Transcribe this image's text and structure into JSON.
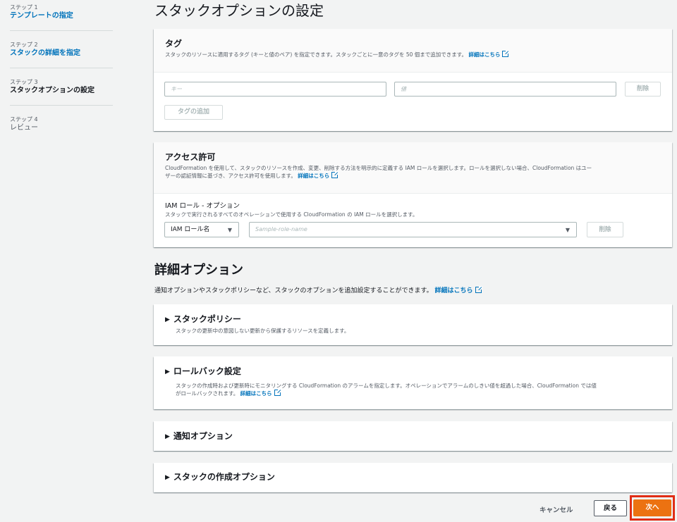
{
  "sidebar": {
    "steps": [
      {
        "num": "ステップ 1",
        "title": "テンプレートの指定"
      },
      {
        "num": "ステップ 2",
        "title": "スタックの詳細を指定"
      },
      {
        "num": "ステップ 3",
        "title": "スタックオプションの設定"
      },
      {
        "num": "ステップ 4",
        "title": "レビュー"
      }
    ]
  },
  "page_title": "スタックオプションの設定",
  "tags_panel": {
    "title": "タグ",
    "desc": "スタックのリソースに適用するタグ (キーと値のペア) を指定できます。スタックごとに一意のタグを 50 個まで追加できます。",
    "learn_more": "詳細はこちら",
    "key_placeholder": "キー",
    "value_placeholder": "値",
    "remove_label": "削除",
    "add_tag_label": "タグの追加"
  },
  "permissions_panel": {
    "title": "アクセス許可",
    "desc_line1": "CloudFormation を使用して、スタックのリソースを作成、変更、削除する方法を明示的に定義する IAM ロールを選択します。ロールを選択しない場合、CloudFormation はユー",
    "desc_line2": "ザーの認証情報に基づき、アクセス許可を使用します。",
    "learn_more": "詳細はこちら",
    "iam_label": "IAM ロール - オプション",
    "iam_desc": "スタックで実行されるすべてのオペレーションで使用する CloudFormation の IAM ロールを選択します。",
    "iam_select": "IAM ロール名",
    "role_placeholder": "Sample-role-name",
    "remove_label": "削除"
  },
  "advanced": {
    "title": "詳細オプション",
    "desc": "通知オプションやスタックポリシーなど、スタックのオプションを追加設定することができます。",
    "learn_more": "詳細はこちら",
    "sections": [
      {
        "title": "スタックポリシー",
        "desc": "スタックの更新中の意図しない更新から保護するリソースを定義します。"
      },
      {
        "title": "ロールバック設定",
        "desc_line1": "スタックの作成時および更新時にモニタリングする CloudFormation のアラームを指定します。オペレーションでアラームのしきい値を超過した場合、CloudFormation では値",
        "desc_line2": "がロールバックされます。",
        "learn_more": "詳細はこちら"
      },
      {
        "title": "通知オプション"
      },
      {
        "title": "スタックの作成オプション"
      }
    ]
  },
  "footer": {
    "cancel": "キャンセル",
    "back": "戻る",
    "next": "次へ"
  }
}
